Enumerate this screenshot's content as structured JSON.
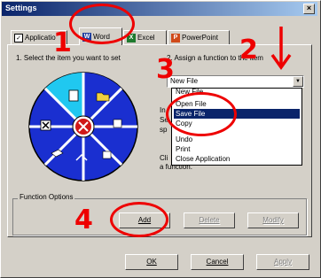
{
  "window": {
    "title": "Settings",
    "close_glyph": "×"
  },
  "tabs": [
    {
      "label": "Application",
      "display": "Applicatio",
      "icon": "app-icon"
    },
    {
      "label": "Word",
      "icon": "word-icon",
      "icon_text": "W",
      "icon_color": "#1f3f9f"
    },
    {
      "label": "Excel",
      "icon": "excel-icon",
      "icon_text": "X",
      "icon_color": "#1e7a2e"
    },
    {
      "label": "PowerPoint",
      "icon": "powerpoint-icon",
      "icon_text": "P",
      "icon_color": "#d04a1a"
    }
  ],
  "left": {
    "instruction": "1. Select the item you want to set"
  },
  "right": {
    "instruction": "2. Assign a function to the item",
    "selected_value": "New File",
    "options": [
      "New File",
      "Open File",
      "Save File",
      "Copy",
      "Undo",
      "Print",
      "Close Application"
    ],
    "highlighted": "Save File",
    "partial_text_1": "In",
    "partial_text_2": "Se",
    "partial_text_3": "sp",
    "partial_text_4": "Cli",
    "partial_text_5": "a function."
  },
  "function_options": {
    "legend": "Function Options",
    "add": "Add",
    "delete": "Delete",
    "modify": "Modify"
  },
  "footer": {
    "ok": "OK",
    "cancel": "Cancel",
    "apply": "Apply"
  },
  "annotations": [
    "1",
    "2",
    "3",
    "4"
  ],
  "colors": {
    "wheel": "#1a2fd0",
    "wheel_center": "#d01818",
    "selected_segment": "#20c8f0",
    "annotation": "#e00000"
  }
}
